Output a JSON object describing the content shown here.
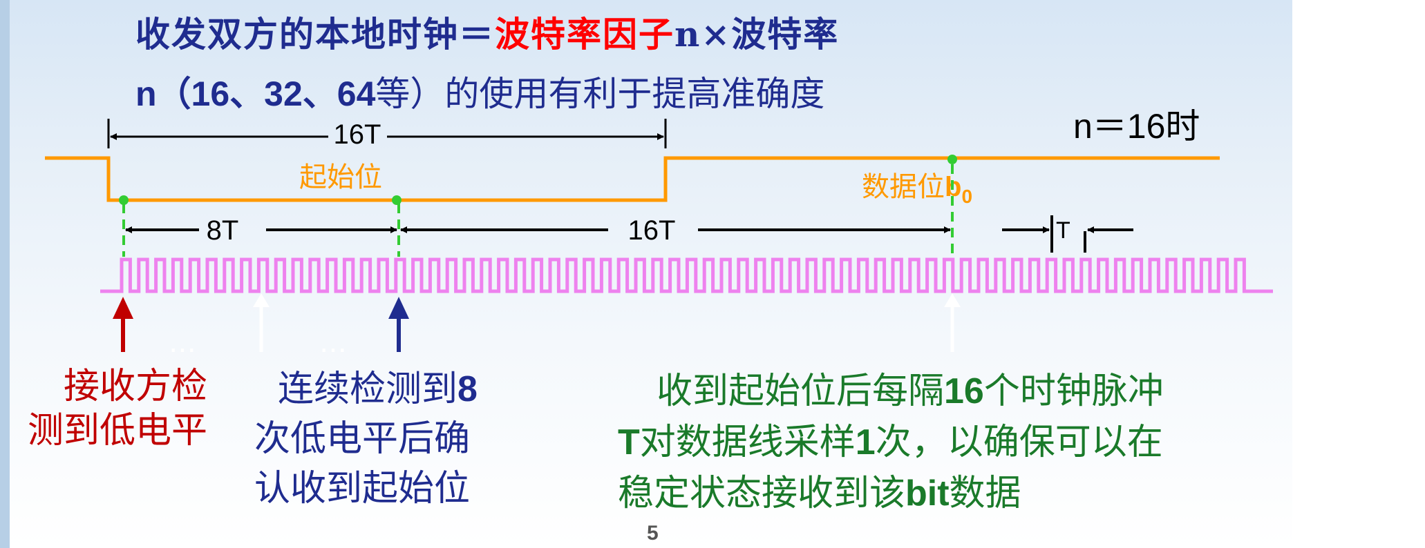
{
  "title": {
    "line1_prefix": "收发双方的本地时钟＝",
    "line1_highlight": "波特率因子",
    "line1_n": "n",
    "line1_suffix": "×波特率",
    "line2_n": "n",
    "line2_nums_open": "（",
    "num16": "16",
    "sep1": "、",
    "num32": "32",
    "sep2": "、",
    "num64": "64",
    "line2_rest": "等）的使用有利于提高准确度"
  },
  "diagram": {
    "n_label": "n＝16时",
    "span_16t_top": "16T",
    "start_bit": "起始位",
    "data_bit": "数据位",
    "data_bit_b": "b",
    "data_bit_sub": "0",
    "span_8t": "8T",
    "span_16t": "16T",
    "period_t": "T",
    "dots1": "…",
    "dots2": "…"
  },
  "notes": {
    "left": [
      "接收方检",
      "测到低电平"
    ],
    "middle_line1_text": "连续检测到",
    "middle_line1_num": "8",
    "middle": [
      "次低电平后确",
      "认收到起始位"
    ],
    "right_line1_text": "收到起始位后每隔",
    "right_line1_num": "16",
    "right_line1_rest": "个时钟脉冲",
    "right_line2_T": "T",
    "right_line2_a": "对数据线采样",
    "right_line2_num": "1",
    "right_line2_b": "次，以确保可以在",
    "right_line3_a": "稳定状态接收到该",
    "right_line3_bit": "bit",
    "right_line3_b": "数据"
  },
  "page_number": "5",
  "colors": {
    "title_blue": "#1f2c8f",
    "title_red": "#ff0000",
    "signal_orange": "#ff9900",
    "clock_pink": "#ee82ee",
    "marker_green": "#33cc33",
    "arrow_red": "#c00000",
    "arrow_blue": "#1f2c8f",
    "note_green": "#1a7a2a",
    "note_red": "#c00000",
    "note_blue": "#1f2c8f"
  }
}
